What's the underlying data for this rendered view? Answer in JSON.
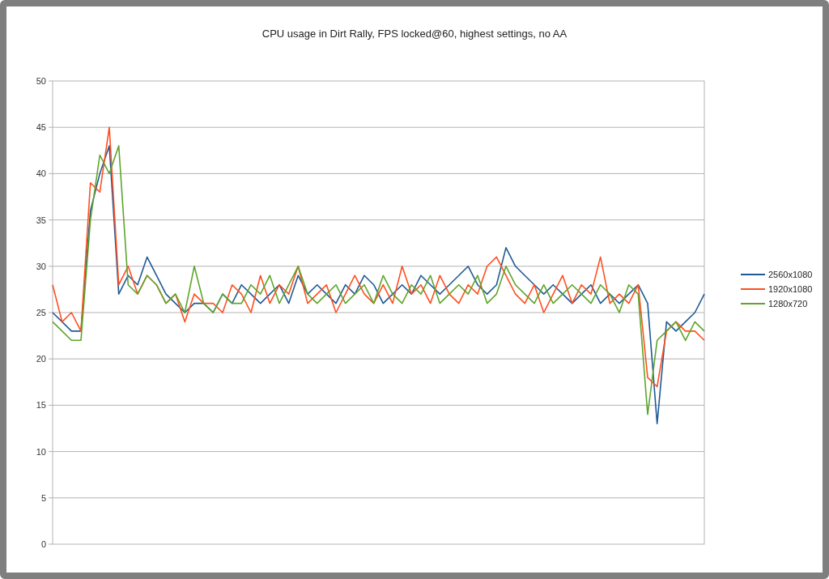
{
  "chart": {
    "chart_data": {
      "type": "line",
      "title": "CPU usage in Dirt Rally, FPS locked@60, highest settings, no AA",
      "ylim": [
        0,
        50
      ],
      "grid": "y",
      "legend": "right",
      "yticks": [
        0,
        5,
        10,
        15,
        20,
        25,
        30,
        35,
        40,
        45,
        50
      ],
      "series": [
        {
          "name": "2560x1080",
          "color": "#1f5a96",
          "values": [
            25,
            24,
            23,
            23,
            36,
            40,
            43,
            27,
            29,
            28,
            31,
            29,
            27,
            26,
            25,
            26,
            26,
            25,
            27,
            26,
            28,
            27,
            26,
            27,
            28,
            26,
            29,
            27,
            28,
            27,
            26,
            28,
            27,
            29,
            28,
            26,
            27,
            28,
            27,
            29,
            28,
            27,
            28,
            29,
            30,
            28,
            27,
            28,
            32,
            30,
            29,
            28,
            27,
            28,
            27,
            26,
            27,
            28,
            26,
            27,
            26,
            27,
            28,
            26,
            13,
            24,
            23,
            24,
            25,
            27
          ]
        },
        {
          "name": "1920x1080",
          "color": "#ff4f1f",
          "values": [
            28,
            24,
            25,
            23,
            39,
            38,
            45,
            28,
            30,
            27,
            29,
            28,
            26,
            27,
            24,
            27,
            26,
            26,
            25,
            28,
            27,
            25,
            29,
            26,
            28,
            27,
            30,
            26,
            27,
            28,
            25,
            27,
            29,
            27,
            26,
            28,
            26,
            30,
            27,
            28,
            26,
            29,
            27,
            26,
            28,
            27,
            30,
            31,
            29,
            27,
            26,
            28,
            25,
            27,
            29,
            26,
            28,
            27,
            31,
            26,
            27,
            26,
            28,
            18,
            17,
            23,
            24,
            23,
            23,
            22
          ]
        },
        {
          "name": "1280x720",
          "color": "#5ea52c",
          "values": [
            24,
            23,
            22,
            22,
            35,
            42,
            40,
            43,
            28,
            27,
            29,
            28,
            26,
            27,
            25,
            30,
            26,
            25,
            27,
            26,
            26,
            28,
            27,
            29,
            26,
            28,
            30,
            27,
            26,
            27,
            28,
            26,
            27,
            28,
            26,
            29,
            27,
            26,
            28,
            27,
            29,
            26,
            27,
            28,
            27,
            29,
            26,
            27,
            30,
            28,
            27,
            26,
            28,
            26,
            27,
            28,
            27,
            26,
            28,
            27,
            25,
            28,
            27,
            14,
            22,
            23,
            24,
            22,
            24,
            23
          ]
        }
      ]
    }
  }
}
